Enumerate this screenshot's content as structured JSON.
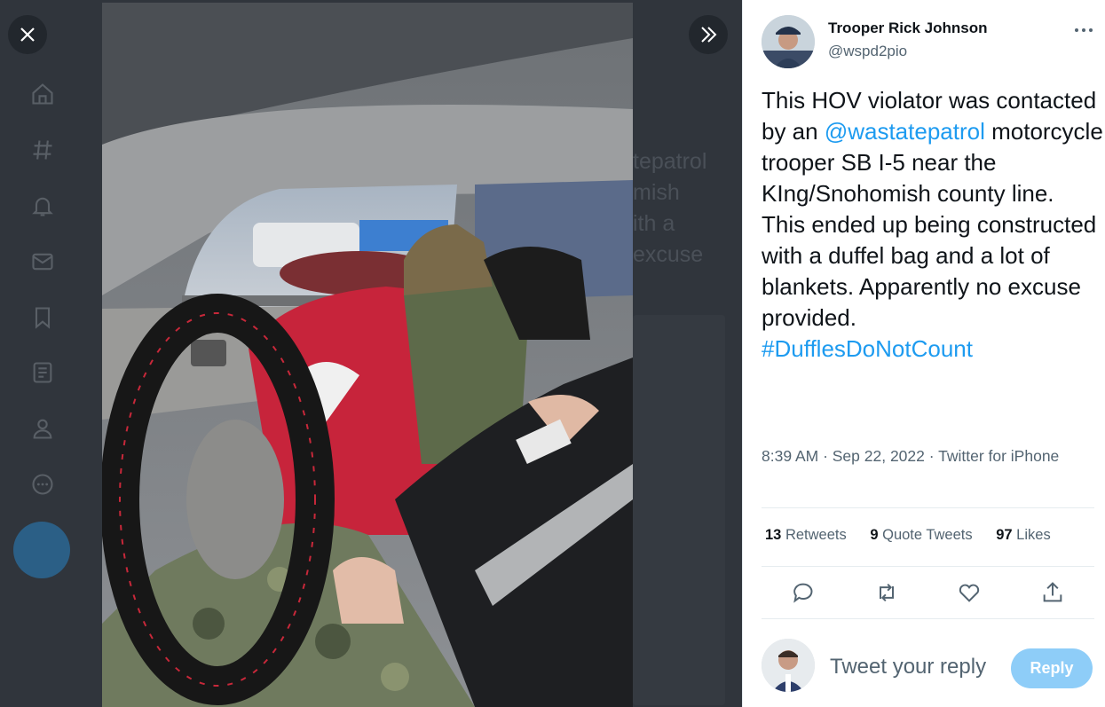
{
  "modal": {
    "close_icon": "close-icon",
    "next_icon": "chevron-double-right-icon",
    "photo_description_icon": "tweet-photo"
  },
  "background": {
    "ghost_text": "tepatrol\nmish\nith a\nexcuse"
  },
  "tweet": {
    "author": {
      "name": "Trooper Rick Johnson",
      "handle": "@wspd2pio"
    },
    "text_parts": {
      "p1": "This HOV violator was contacted by an ",
      "mention": "@wastatepatrol",
      "p2": " motorcycle trooper SB I-5 near the KIng/Snohomish county line. This ended up being constructed with a duffel bag and a lot of blankets. Apparently no excuse provided.",
      "hashtag": "#DufflesDoNotCount"
    },
    "meta": "8:39 AM · Sep 22, 2022 · Twitter for iPhone",
    "stats": {
      "retweets_count": "13",
      "retweets_label": "Retweets",
      "quotes_count": "9",
      "quotes_label": "Quote Tweets",
      "likes_count": "97",
      "likes_label": "Likes"
    }
  },
  "reply": {
    "placeholder": "Tweet your reply",
    "button_label": "Reply"
  },
  "colors": {
    "accent": "#1d9bf0",
    "reply_button": "#8ecdf8",
    "modal_overlay": "#30353c"
  }
}
